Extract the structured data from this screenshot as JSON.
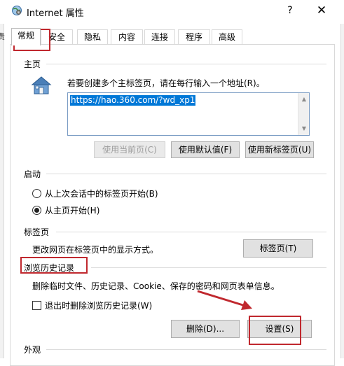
{
  "window": {
    "title": "Internet 属性",
    "help_glyph": "?",
    "close_glyph": "✕",
    "background_left_fragment": "费"
  },
  "tabs": [
    {
      "label": "常规",
      "active": true
    },
    {
      "label": "安全",
      "active": false
    },
    {
      "label": "隐私",
      "active": false
    },
    {
      "label": "内容",
      "active": false
    },
    {
      "label": "连接",
      "active": false
    },
    {
      "label": "程序",
      "active": false
    },
    {
      "label": "高级",
      "active": false
    }
  ],
  "homepage": {
    "group_label": "主页",
    "icon": "house-icon",
    "instruction": "若要创建多个主标签页，请在每行输入一个地址(R)。",
    "url_value": "https://hao.360.com/?wd_xp1",
    "buttons": {
      "use_current": "使用当前页(C)",
      "use_default": "使用默认值(F)",
      "use_new_tab": "使用新标签页(U)"
    }
  },
  "startup": {
    "group_label": "启动",
    "options": [
      {
        "label": "从上次会话中的标签页开始(B)",
        "checked": false
      },
      {
        "label": "从主页开始(H)",
        "checked": true
      }
    ]
  },
  "tabs_section": {
    "group_label": "标签页",
    "description": "更改网页在标签页中的显示方式。",
    "button": "标签页(T)"
  },
  "history": {
    "group_label": "浏览历史记录",
    "description": "删除临时文件、历史记录、Cookie、保存的密码和网页表单信息。",
    "checkbox_label": "退出时删除浏览历史记录(W)",
    "checkbox_checked": false,
    "delete_button": "删除(D)...",
    "settings_button": "设置(S)"
  },
  "appearance": {
    "group_label": "外观"
  },
  "colors": {
    "accent_selection": "#0078d7",
    "annotation_red": "#c0282e"
  }
}
